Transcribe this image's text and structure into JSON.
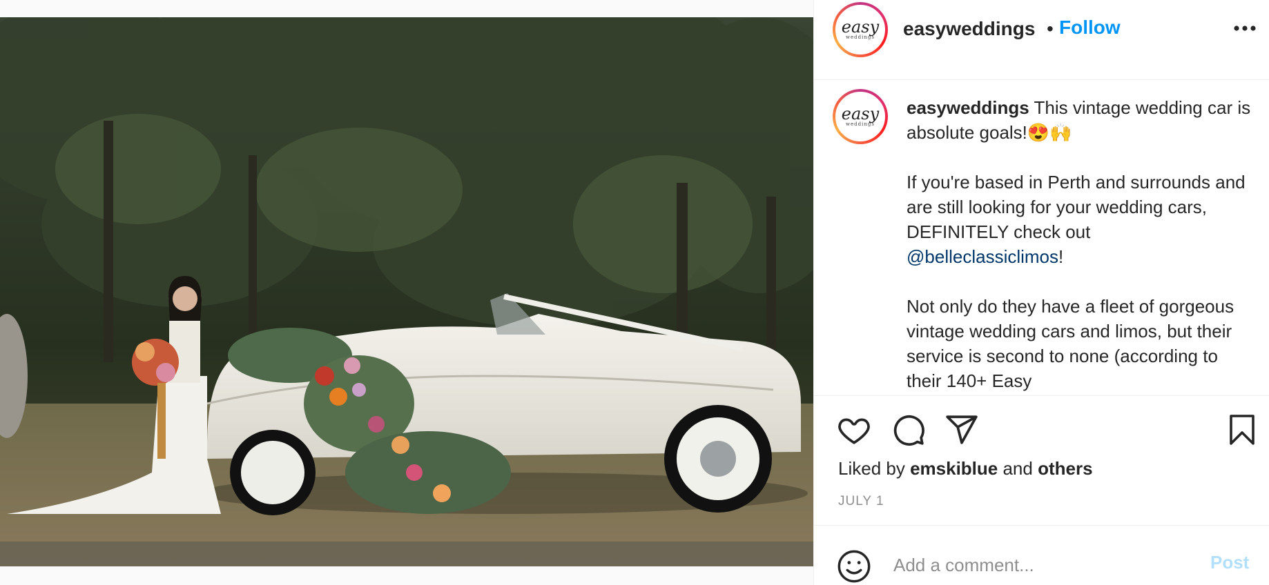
{
  "post": {
    "username": "easyweddings",
    "avatar": {
      "brand": "easy",
      "brand_sub": "weddings"
    },
    "header": {
      "separator": "•",
      "follow_label": "Follow"
    },
    "caption": {
      "username": "easyweddings",
      "line1": "This vintage wedding car is absolute goals!😍🙌",
      "line2_pre": "If you're based in Perth and surrounds and are still looking for your wedding cars, DEFINITELY check out ",
      "mention": "@belleclassiclimos",
      "line2_post": "!",
      "line3": "Not only do they have a fleet of gorgeous vintage wedding cars and limos, but their service is second to none (according to their 140+ Easy"
    },
    "likes": {
      "prefix": "Liked by ",
      "user": "emskiblue",
      "middle": " and ",
      "others": "others"
    },
    "date": "JULY 1",
    "comment": {
      "placeholder": "Add a comment...",
      "post_label": "Post"
    }
  },
  "icons": [
    "like-icon",
    "comment-icon",
    "share-icon",
    "save-icon",
    "emoji-icon",
    "more-icon"
  ],
  "colors": {
    "follow": "#0095f6",
    "mention": "#00376b",
    "post_disabled": "#b2dffc",
    "muted": "#8e8e8e"
  }
}
